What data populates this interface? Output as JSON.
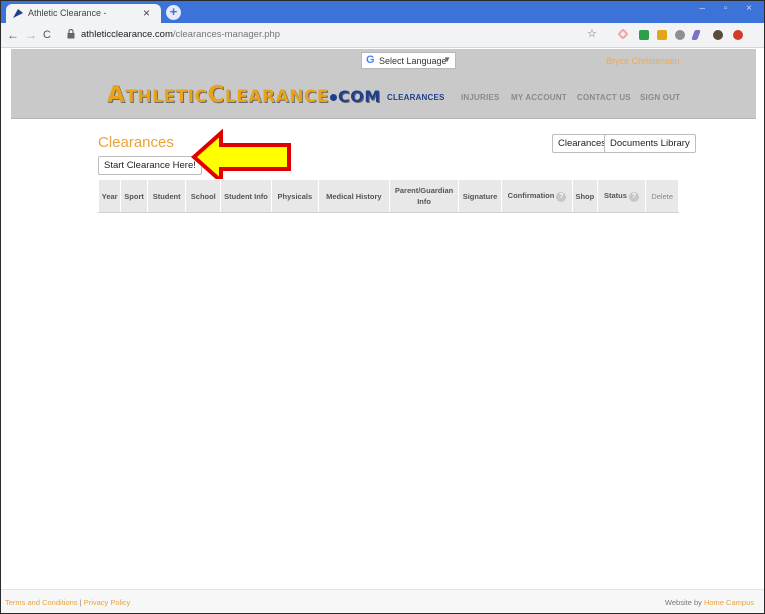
{
  "browser": {
    "tab_title": "Athletic Clearance -",
    "tab_close": "×",
    "new_tab": "+",
    "window_controls": "– ▫ ×",
    "back": "←",
    "forward": "→",
    "reload": "C",
    "url_host": "athleticclearance.com",
    "url_path": "/clearances-manager.php",
    "star": "☆",
    "extension_colors": [
      "#f4a3a3",
      "#2e9e4a",
      "#e6a419",
      "#8f8f8f",
      "#7e6fc9",
      "#5a4a3a",
      "#d23b2a"
    ],
    "tab_bar_color": "#3b73d8"
  },
  "header": {
    "translate_logo": "G",
    "language_select": "Select Language",
    "language_caret": "▼",
    "user_name": "Bryce Christensen",
    "logo_initial_1": "A",
    "logo_rest_1": "THLETIC",
    "logo_initial_2": "C",
    "logo_rest_2": "LEARANCE",
    "logo_suffix": "COM",
    "nav": {
      "clearances": "CLEARANCES",
      "injuries": "INJURIES",
      "my_account": "MY ACCOUNT",
      "contact_us": "CONTACT US",
      "sign_out": "SIGN OUT"
    },
    "accent_color": "#e8a33d",
    "brand_blue": "#1f3f8e"
  },
  "main": {
    "title": "Clearances",
    "start_button": "Start Clearance Here!",
    "clearances_button": "Clearances",
    "documents_button": "Documents Library",
    "table": {
      "year": "Year",
      "sport": "Sport",
      "student": "Student",
      "school": "School",
      "student_info": "Student Info",
      "physicals": "Physicals",
      "medical_history": "Medical History",
      "parent_guardian": "Parent/Guardian",
      "info": "Info",
      "signature": "Signature",
      "confirmation": "Confirmation",
      "shop": "Shop",
      "status": "Status",
      "delete": "Delete",
      "help_mark": "?"
    },
    "callout_arrow_fill": "#ffff00",
    "callout_arrow_stroke": "#e00000"
  },
  "footer": {
    "terms": "Terms and Conditions",
    "separator": "|",
    "privacy": "Privacy Policy",
    "credit_prefix": "Website by",
    "credit_link": "Home Campus"
  }
}
